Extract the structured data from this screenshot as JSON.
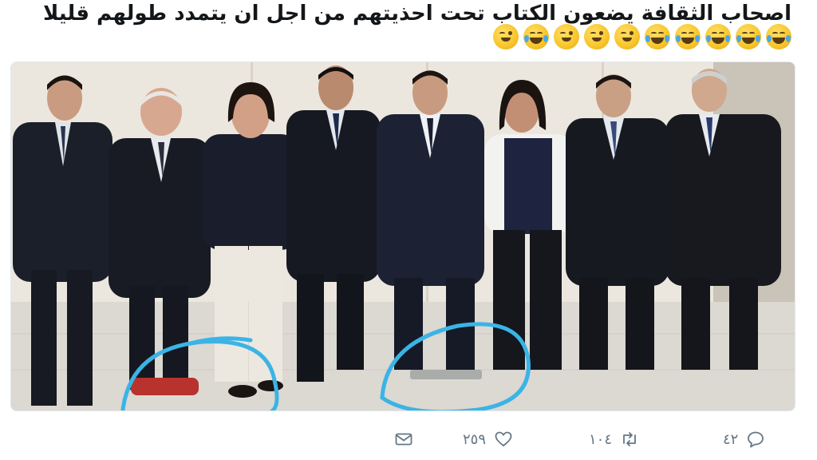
{
  "tweet": {
    "text": "اصحاب الثقافة يضعون الكتاب تحت احذيتهم من اجل ان يتمدد طولهم قليلا",
    "emojis": [
      "face-with-tears-of-joy",
      "face-with-tears-of-joy",
      "face-with-tears-of-joy",
      "face-with-tears-of-joy",
      "face-with-tears-of-joy",
      "winking-face",
      "winking-face",
      "winking-face",
      "face-with-tears-of-joy",
      "winking-face"
    ]
  },
  "media": {
    "description_icon": "photo-of-group"
  },
  "actions": {
    "reply": {
      "icon": "reply-icon",
      "count": "٤٢"
    },
    "retweet": {
      "icon": "retweet-icon",
      "count": "١٠٤"
    },
    "like": {
      "icon": "heart-icon",
      "count": "٢٥٩"
    },
    "message": {
      "icon": "envelope-icon"
    }
  },
  "colors": {
    "text": "#14171a",
    "secondary": "#657786",
    "annotation_circle": "#3ab4e6"
  }
}
